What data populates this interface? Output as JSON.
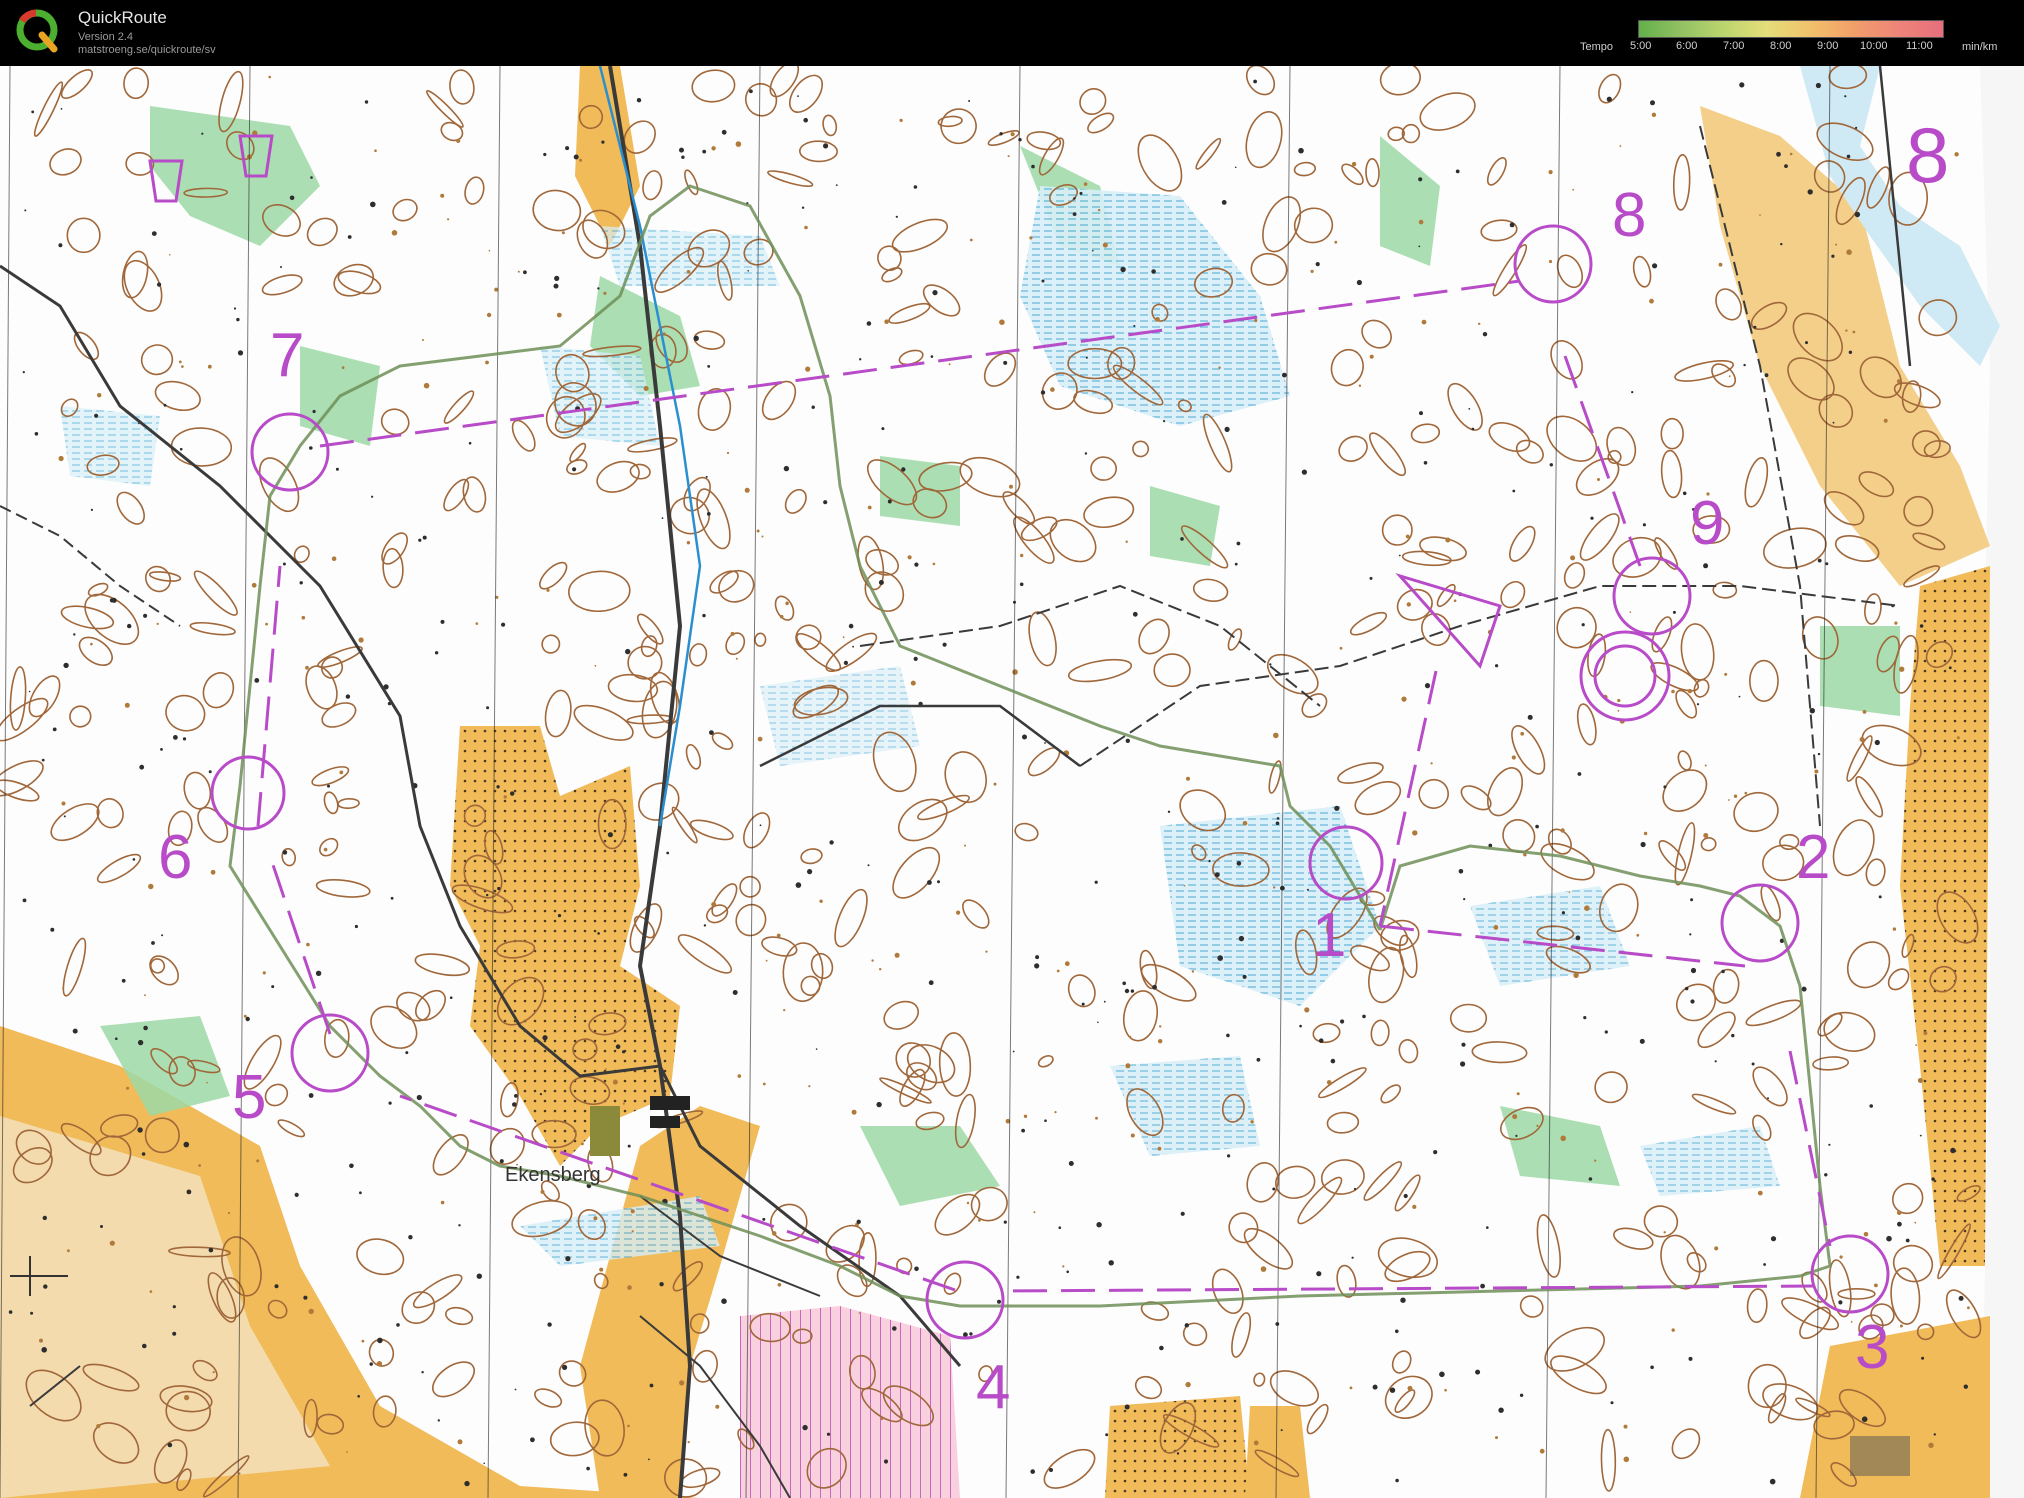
{
  "header": {
    "app_title": "QuickRoute",
    "version": "Version 2.4",
    "url": "matstroeng.se/quickroute/sv"
  },
  "legend": {
    "label": "Tempo",
    "ticks": [
      "5:00",
      "6:00",
      "7:00",
      "8:00",
      "9:00",
      "10:00",
      "11:00"
    ],
    "unit": "min/km"
  },
  "map": {
    "place_name": "Ekensberg",
    "control_numbers": [
      "1",
      "2",
      "3",
      "4",
      "5",
      "6",
      "7",
      "8",
      "9"
    ],
    "corner_label": "8",
    "colors": {
      "course": "#b84bc8",
      "route": "#6f8f58",
      "open_land": "#f0bb58",
      "forest": "#ffffff",
      "green": "#8fd49a",
      "marsh": "#9fd8ee",
      "contour": "#a0673a",
      "road": "#3a3a3a"
    }
  }
}
